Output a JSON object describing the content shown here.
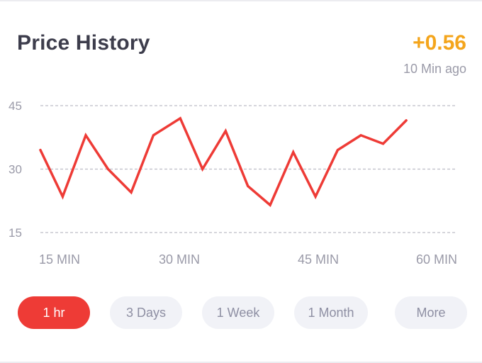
{
  "header": {
    "title": "Price History",
    "change": "+0.56",
    "updated": "10 Min ago"
  },
  "colors": {
    "accent": "#ee3b36",
    "change": "#f4a51c",
    "title": "#3d3d4c",
    "muted": "#9a9aa8",
    "pill_bg": "#f1f2f7"
  },
  "chart_data": {
    "type": "line",
    "title": "",
    "xlabel": "",
    "ylabel": "",
    "x_ticks": [
      "15 MIN",
      "30 MIN",
      "45 MIN",
      "60 MIN"
    ],
    "y_ticks": [
      45,
      30,
      15
    ],
    "ylim": [
      15,
      45
    ],
    "xlim": [
      15,
      60
    ],
    "grid": true,
    "series": [
      {
        "color": "#ee3b36",
        "x": [
          15,
          17.4,
          19.9,
          22.3,
          24.8,
          27.2,
          30.1,
          32.5,
          35,
          37.4,
          39.8,
          42.3,
          44.7,
          47.1,
          49.6,
          52,
          54.5
        ],
        "y": [
          34.5,
          23.5,
          38,
          30,
          24.5,
          38,
          42,
          30,
          39,
          26,
          21.5,
          34,
          23.5,
          34.5,
          38,
          36,
          41.5
        ]
      }
    ]
  },
  "filters": {
    "items": [
      {
        "label": "1 hr",
        "active": true
      },
      {
        "label": "3 Days",
        "active": false
      },
      {
        "label": "1 Week",
        "active": false
      },
      {
        "label": "1 Month",
        "active": false
      },
      {
        "label": "More",
        "active": false
      }
    ]
  }
}
